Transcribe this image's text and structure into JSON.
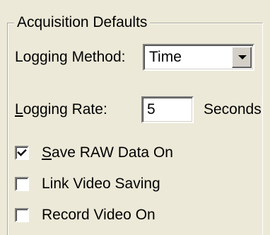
{
  "group": {
    "title": "Acquisition Defaults"
  },
  "logging_method": {
    "label": "Logging Method:",
    "value": "Time"
  },
  "logging_rate": {
    "label_accel": "L",
    "label_rest": "ogging Rate:",
    "value": "5",
    "unit": "Seconds"
  },
  "checkboxes": [
    {
      "accel": "S",
      "rest": "ave RAW Data On",
      "checked": true
    },
    {
      "label": "Link Video Saving",
      "checked": false
    },
    {
      "label": "Record Video On",
      "checked": false
    }
  ]
}
